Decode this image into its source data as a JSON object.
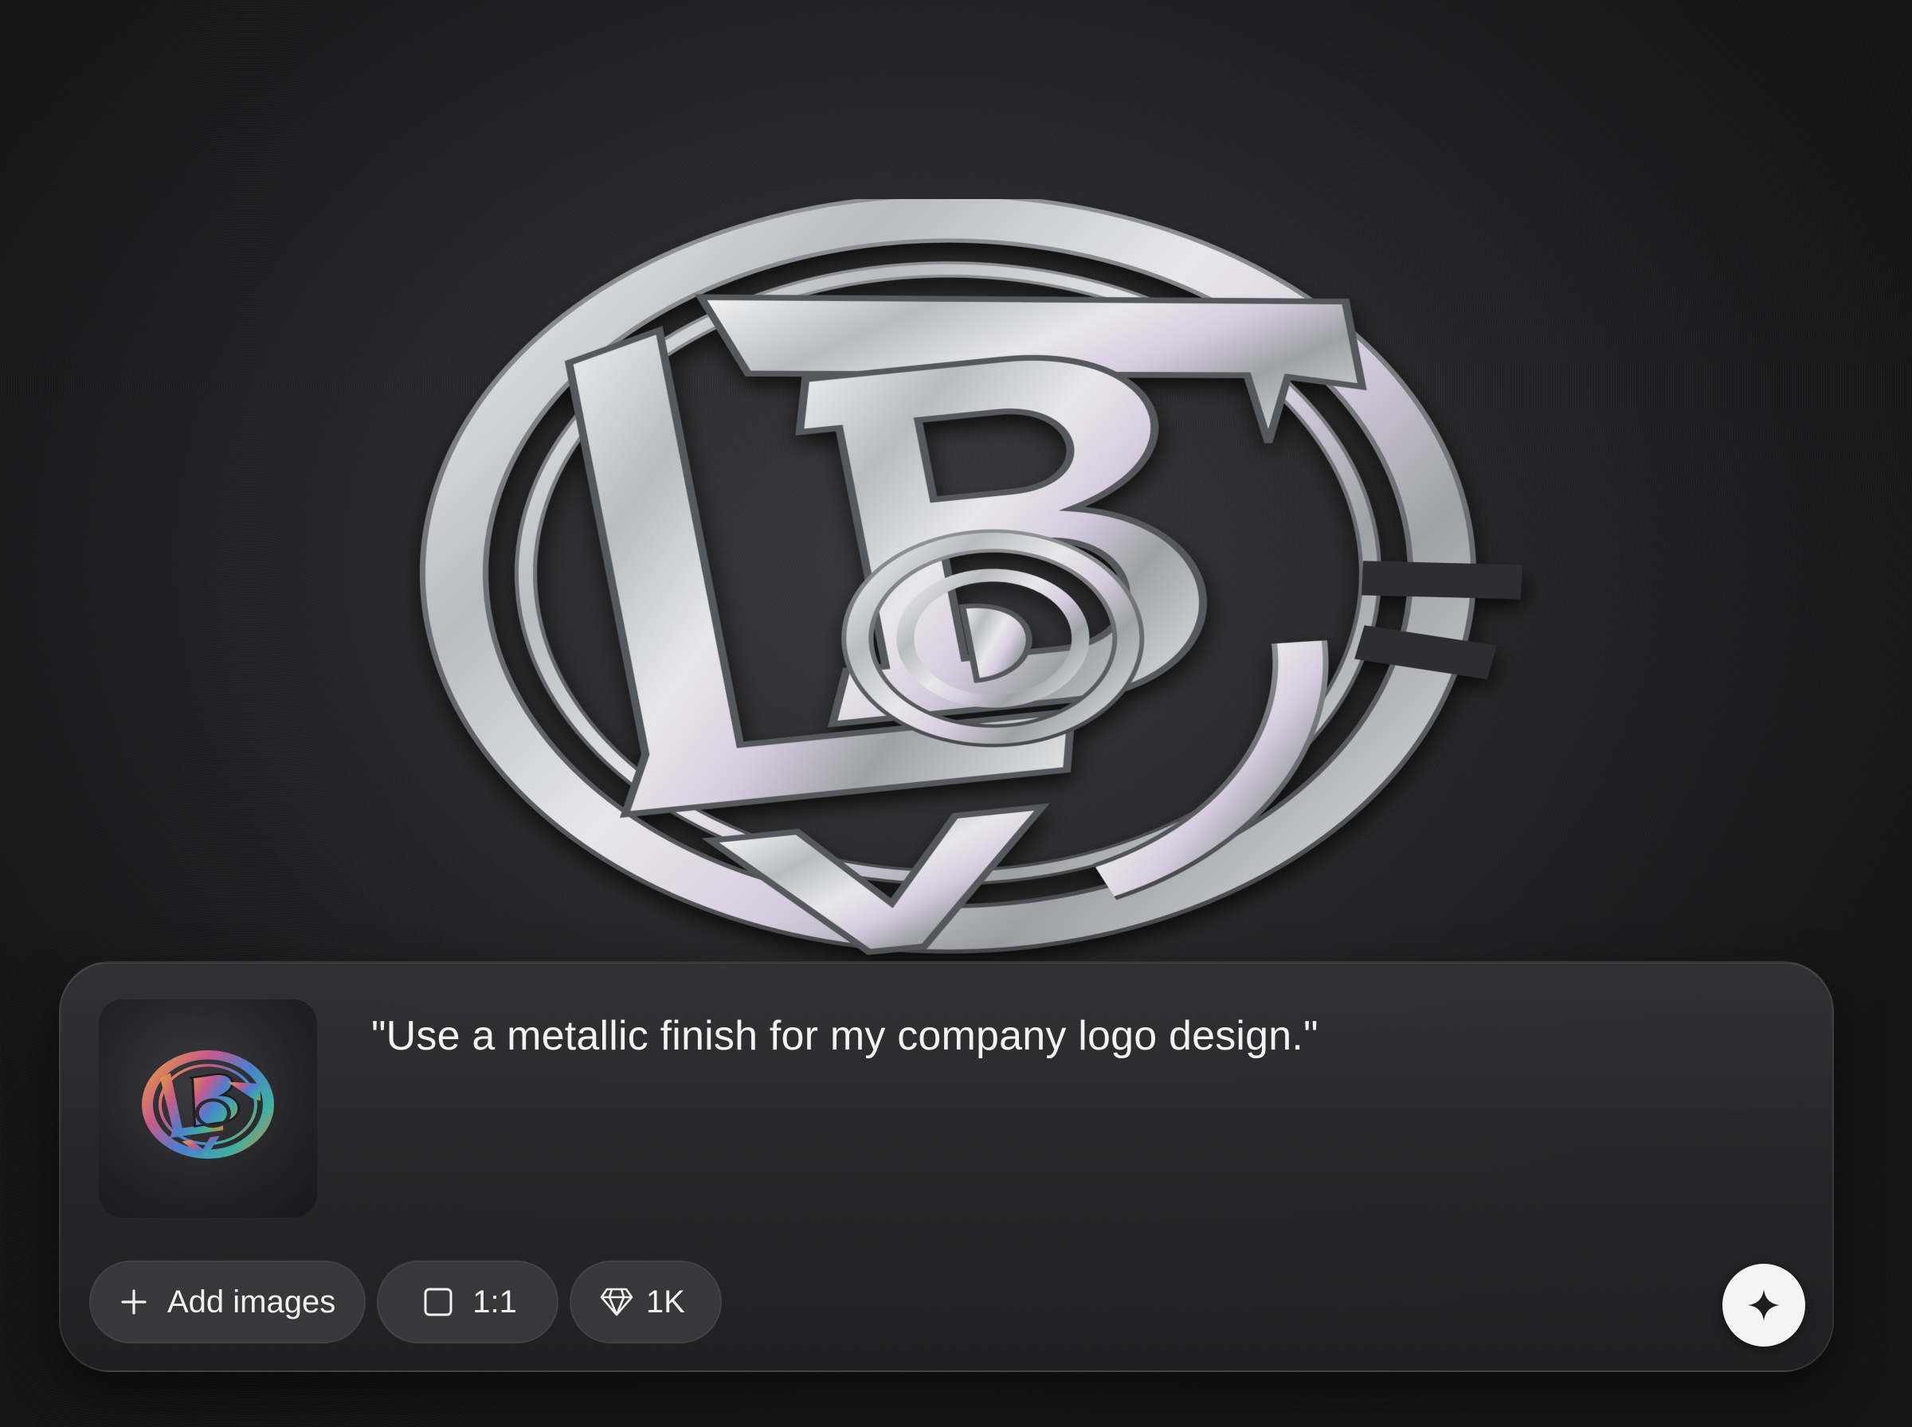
{
  "composer": {
    "prompt_text": "\"Use a metallic finish for my company logo design.\"",
    "reference_thumbnail": "colorful-logo-reference-image",
    "chips": {
      "add_images_label": "Add images",
      "add_images_icon": "plus-icon",
      "aspect_ratio_label": "1:1",
      "aspect_ratio_icon": "square-icon",
      "resolution_label": "1K",
      "resolution_icon": "diamond-icon"
    },
    "generate_button_icon": "sparkle-icon"
  },
  "colors": {
    "background": "#1c1c1e",
    "panel": "#2c2c2e",
    "chip": "#3a3a3d",
    "text": "#f2f2f2",
    "generate_button": "#f3f3f3"
  }
}
